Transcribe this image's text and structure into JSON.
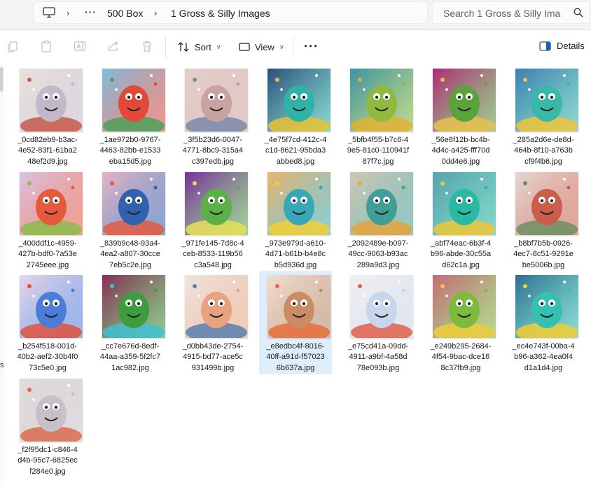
{
  "breadcrumb": {
    "more": "···",
    "items": [
      "500 Box",
      "1 Gross & Silly Images"
    ]
  },
  "search": {
    "placeholder": "Search 1 Gross & Silly Images"
  },
  "toolbar": {
    "sort_label": "Sort",
    "view_label": "View",
    "more_label": "···",
    "details_label": "Details"
  },
  "nav": {
    "partial_label": "s"
  },
  "files": [
    {
      "name": "_0cd82eb9-b3ac-\n4e52-83f1-61ba2\n48ef2d9.jpg",
      "colors": [
        "#e9e2dd",
        "#c2b8c9",
        "#c55a4a"
      ]
    },
    {
      "name": "_1ae972b0-9767-\n4463-82bb-e1533\neba15d5.jpg",
      "colors": [
        "#7fbde0",
        "#e24a37",
        "#4f9f5a"
      ]
    },
    {
      "name": "_3f5b23d6-0047-\n4771-8bc9-315a4\nc397edb.jpg",
      "colors": [
        "#e6cfcb",
        "#c8a3a0",
        "#7a8aa8"
      ]
    },
    {
      "name": "_4e75f7cd-412c-4\nc1d-8621-95bda3\nabbed8.jpg",
      "colors": [
        "#2c4d7d",
        "#2fb3a8",
        "#e8c134"
      ]
    },
    {
      "name": "_5bfb4f55-b7c6-4\n9e5-81c0-110941f\n87f7c.jpg",
      "colors": [
        "#3a93a5",
        "#8fb93f",
        "#e0b233"
      ]
    },
    {
      "name": "_56e8f12b-bc4b-\n4d4c-a425-fff70d\n0dd4e6.jpg",
      "colors": [
        "#b12a7a",
        "#5aa33c",
        "#e7c04e"
      ]
    },
    {
      "name": "_285a2d6e-de8d-\n464b-8f10-a763b\ncf9f4b6.jpg",
      "colors": [
        "#3d7fb2",
        "#39b8a7",
        "#f0c43a"
      ]
    },
    {
      "name": "_400ddf1c-4959-\n427b-bdf0-7a53e\n2745eee.jpg",
      "colors": [
        "#d9c3e6",
        "#e55a3d",
        "#8dbb4a"
      ]
    },
    {
      "name": "_839b9c48-93a4-\n4ea2-a807-30cce\n7eb5c2e.jpg",
      "colors": [
        "#e8b5c6",
        "#3062b0",
        "#e35a3e"
      ]
    },
    {
      "name": "_971fe145-7d8c-4\nceb-8533-119b56\nc3a548.jpg",
      "colors": [
        "#7a2fa0",
        "#5cb04a",
        "#e6df56"
      ]
    },
    {
      "name": "_973e979d-a610-\n4d71-b61b-b4e8c\nb5d936d.jpg",
      "colors": [
        "#ecb56a",
        "#37a8b6",
        "#f2cf34"
      ]
    },
    {
      "name": "_2092489e-b097-\n49cc-9063-b93ac\n289a9d3.jpg",
      "colors": [
        "#d4c7b4",
        "#3f9e96",
        "#e4a53b"
      ]
    },
    {
      "name": "_abf74eac-6b3f-4\nb96-abde-30c55a\nd62c1a.jpg",
      "colors": [
        "#5aa2ad",
        "#2ab9a2",
        "#f0c732"
      ]
    },
    {
      "name": "_b8bf7b5b-0926-\n4ec7-8c51-9291e\nbe5006b.jpg",
      "colors": [
        "#e6d7d4",
        "#c95e4b",
        "#6c8f64"
      ]
    },
    {
      "name": "_b254f518-001d-\n40b2-aef2-30b4f0\n73c5e0.jpg",
      "colors": [
        "#e8d7ea",
        "#4b7cd8",
        "#e0523f"
      ]
    },
    {
      "name": "_cc7e676d-8edf-\n44aa-a359-5f2fc7\n1ac982.jpg",
      "colors": [
        "#8a2d56",
        "#3f9c3c",
        "#3fc0cf"
      ]
    },
    {
      "name": "_d0bb43de-2754-\n4915-bd77-ace5c\n931499b.jpg",
      "colors": [
        "#ede6e0",
        "#e8a27f",
        "#5a7fb0"
      ]
    },
    {
      "name": "_e8edbc4f-8016-\n40ff-a91d-f57023\n6b637a.jpg",
      "colors": [
        "#f1e0cf",
        "#c98c66",
        "#e86d3b"
      ]
    },
    {
      "name": "_e75cd41a-09dd-\n4911-a9bf-4a58d\n78e093b.jpg",
      "colors": [
        "#f2efee",
        "#c7d6ea",
        "#e0604a"
      ]
    },
    {
      "name": "_e249b295-2684-\n4f54-9bac-dce16\n8c37fb9.jpg",
      "colors": [
        "#c66a7c",
        "#7dba3e",
        "#efcb3a"
      ]
    },
    {
      "name": "_ec4e743f-00ba-4\nb96-a362-4ea0f4\nd1a1d4.jpg",
      "colors": [
        "#2d6e92",
        "#35c0b2",
        "#f3cc2f"
      ]
    },
    {
      "name": "_f2f95dc1-c846-4\nd4b-95c7-6825ec\nf284e0.jpg",
      "colors": [
        "#e0dcdc",
        "#c7c0c6",
        "#d96c4e"
      ]
    }
  ],
  "selected_file_index": 17
}
